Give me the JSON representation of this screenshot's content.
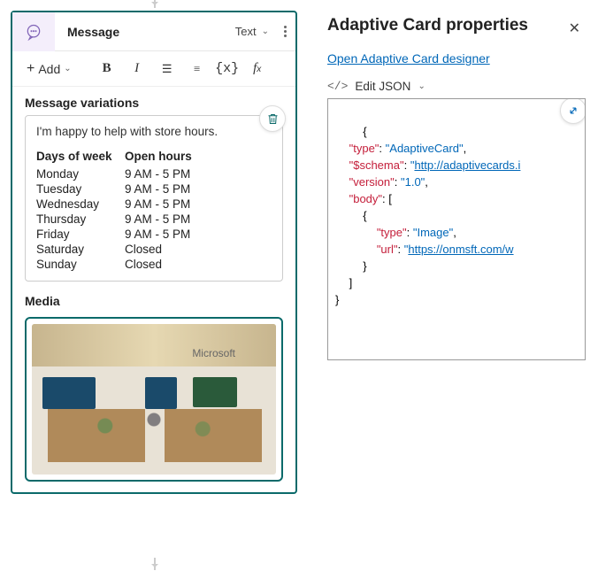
{
  "card": {
    "title": "Message",
    "typeLabel": "Text",
    "addLabel": "Add"
  },
  "sections": {
    "variationsTitle": "Message variations",
    "mediaTitle": "Media",
    "intro": "I'm happy to help with store hours.",
    "headers": {
      "days": "Days of week",
      "hours": "Open hours"
    },
    "rows": [
      {
        "day": "Monday",
        "hours": "9 AM - 5 PM"
      },
      {
        "day": "Tuesday",
        "hours": "9 AM - 5 PM"
      },
      {
        "day": "Wednesday",
        "hours": "9 AM - 5 PM"
      },
      {
        "day": "Thursday",
        "hours": "9 AM - 5 PM"
      },
      {
        "day": "Friday",
        "hours": "9 AM - 5 PM"
      },
      {
        "day": "Saturday",
        "hours": "Closed"
      },
      {
        "day": "Sunday",
        "hours": "Closed"
      }
    ],
    "imageSign": "Microsoft"
  },
  "props": {
    "title": "Adaptive Card properties",
    "designerLink": "Open Adaptive Card designer",
    "editJsonLabel": "Edit JSON",
    "json": {
      "l1": "{",
      "l2k": "\"type\"",
      "l2v": "\"AdaptiveCard\"",
      "l3k": "\"$schema\"",
      "l3v": "\"",
      "l3u": "http://adaptivecards.i",
      "l4k": "\"version\"",
      "l4v": "\"1.0\"",
      "l5k": "\"body\"",
      "l7k": "\"type\"",
      "l7v": "\"Image\"",
      "l8k": "\"url\"",
      "l8v": "\"",
      "l8u": "https://onmsft.com/w",
      "l10": "]",
      "l11": "}"
    }
  }
}
